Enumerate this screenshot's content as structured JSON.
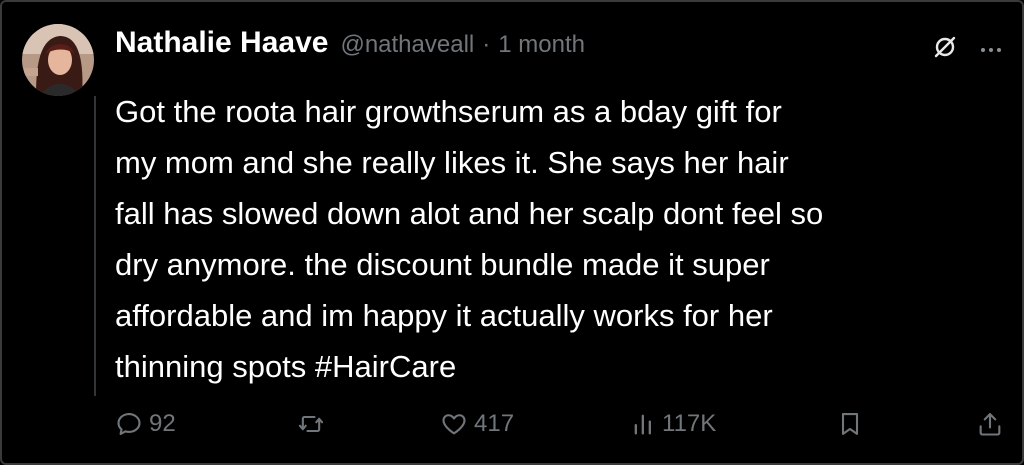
{
  "post": {
    "author_name": "Nathalie Haave",
    "handle": "@nathaveall",
    "separator": "·",
    "time": "1 month",
    "text": "Got the roota hair growthserum as a bday gift for\nmy mom and she really likes it. She says her hair\nfall has slowed down alot and her scalp dont feel so\ndry anymore. the discount bundle made it super\naffordable and im happy it actually works for her\nthinning spots #HairCare"
  },
  "actions": {
    "replies": "92",
    "likes": "417",
    "views": "117K"
  },
  "icons": [
    "avatar",
    "no-sign-icon",
    "more-icon",
    "reply-icon",
    "retweet-icon",
    "like-icon",
    "views-icon",
    "bookmark-icon",
    "share-icon"
  ],
  "colors": {
    "background": "#000000",
    "text": "#ffffff",
    "muted": "#71767b"
  }
}
